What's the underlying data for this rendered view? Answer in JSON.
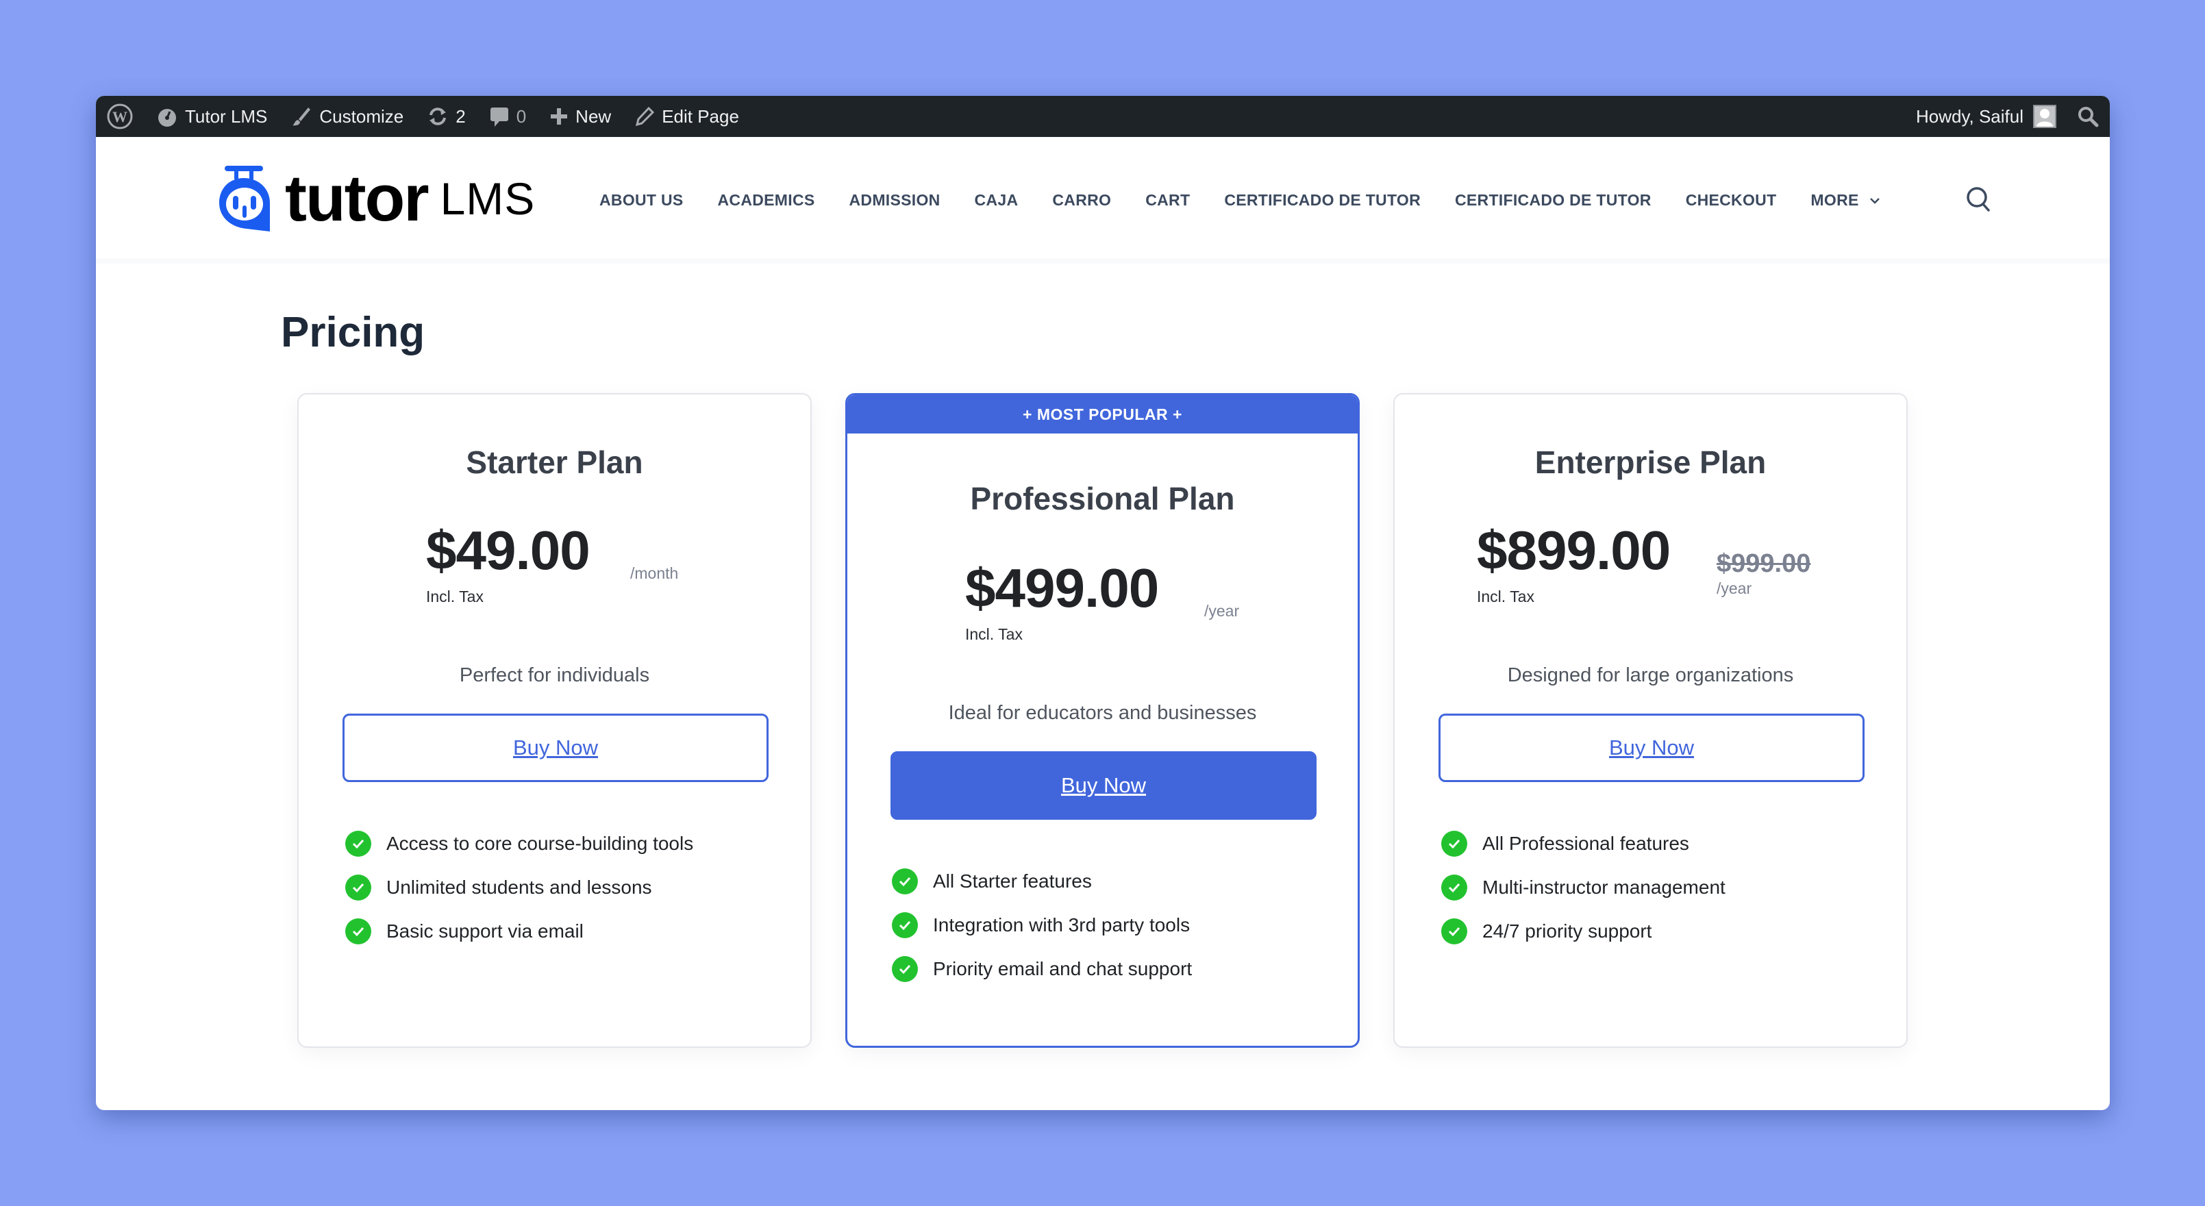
{
  "adminbar": {
    "site_name": "Tutor LMS",
    "customize": "Customize",
    "updates_count": "2",
    "comments_count": "0",
    "new": "New",
    "edit_page": "Edit Page",
    "greeting": "Howdy, Saiful"
  },
  "header": {
    "logo_word": "tutor",
    "logo_suffix": "LMS",
    "nav": [
      "ABOUT US",
      "ACADEMICS",
      "ADMISSION",
      "CAJA",
      "CARRO",
      "CART",
      "CERTIFICADO DE TUTOR",
      "CERTIFICADO DE TUTOR",
      "CHECKOUT"
    ],
    "more": "MORE"
  },
  "page": {
    "title": "Pricing"
  },
  "colors": {
    "accent": "#4166dc",
    "check": "#22c22f",
    "adminbar": "#1d2327",
    "background": "#87a0f5"
  },
  "plans": [
    {
      "title": "Starter Plan",
      "price": "$49.00",
      "incl_tax": "Incl. Tax",
      "period": "/month",
      "tagline": "Perfect for individuals",
      "cta": "Buy Now",
      "features": [
        "Access to core course-building tools",
        "Unlimited students and lessons",
        "Basic support via email"
      ]
    },
    {
      "badge": "+ MOST POPULAR +",
      "title": "Professional Plan",
      "price": "$499.00",
      "incl_tax": "Incl. Tax",
      "period": "/year",
      "tagline": "Ideal for educators and businesses",
      "cta": "Buy Now",
      "features": [
        "All Starter features",
        "Integration with 3rd party tools",
        "Priority email and chat support"
      ]
    },
    {
      "title": "Enterprise Plan",
      "price": "$899.00",
      "old_price": "$999.00",
      "incl_tax": "Incl. Tax",
      "period": "/year",
      "tagline": "Designed for large organizations",
      "cta": "Buy Now",
      "features": [
        "All Professional features",
        "Multi-instructor management",
        "24/7 priority support"
      ]
    }
  ]
}
